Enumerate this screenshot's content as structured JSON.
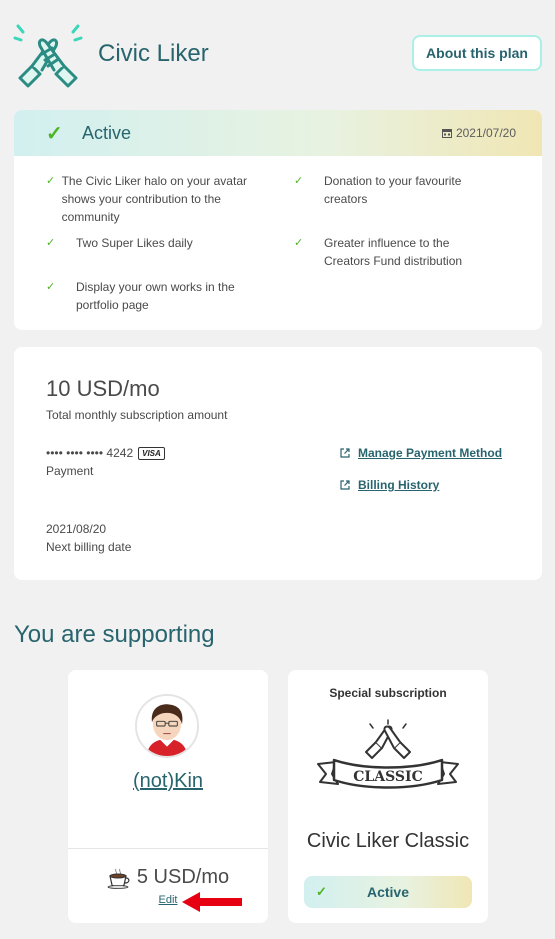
{
  "header": {
    "title": "Civic Liker",
    "about_button": "About this plan"
  },
  "plan": {
    "status": "Active",
    "date": "2021/07/20",
    "features": [
      "The Civic Liker halo on your avatar shows your contribution to the community",
      "Donation to your favourite creators",
      "Two Super Likes daily",
      "Greater influence to the Creators Fund distribution",
      "Display your own works in the portfolio page"
    ]
  },
  "payment": {
    "amount": "10 USD/mo",
    "amount_label": "Total monthly subscription amount",
    "card_masked": "•••• •••• •••• 4242",
    "card_brand": "VISA",
    "payment_label": "Payment",
    "manage_link": "Manage Payment Method",
    "history_link": "Billing History",
    "next_date": "2021/08/20",
    "next_date_label": "Next billing date"
  },
  "supporting": {
    "title": "You are supporting",
    "creator": {
      "name": "(not)Kin",
      "price": "5 USD/mo",
      "edit": "Edit"
    },
    "special": {
      "label": "Special subscription",
      "badge_text": "CLASSIC",
      "name": "Civic Liker Classic",
      "status": "Active"
    }
  },
  "colors": {
    "accent": "#28646e",
    "check": "#50b428",
    "arrow": "#e60012"
  },
  "icons": {
    "logo": "handshake-logo-icon",
    "calendar": "calendar-icon",
    "external": "external-link-icon",
    "coffee": "coffee-cup-icon",
    "arrow": "red-arrow-annotation"
  }
}
